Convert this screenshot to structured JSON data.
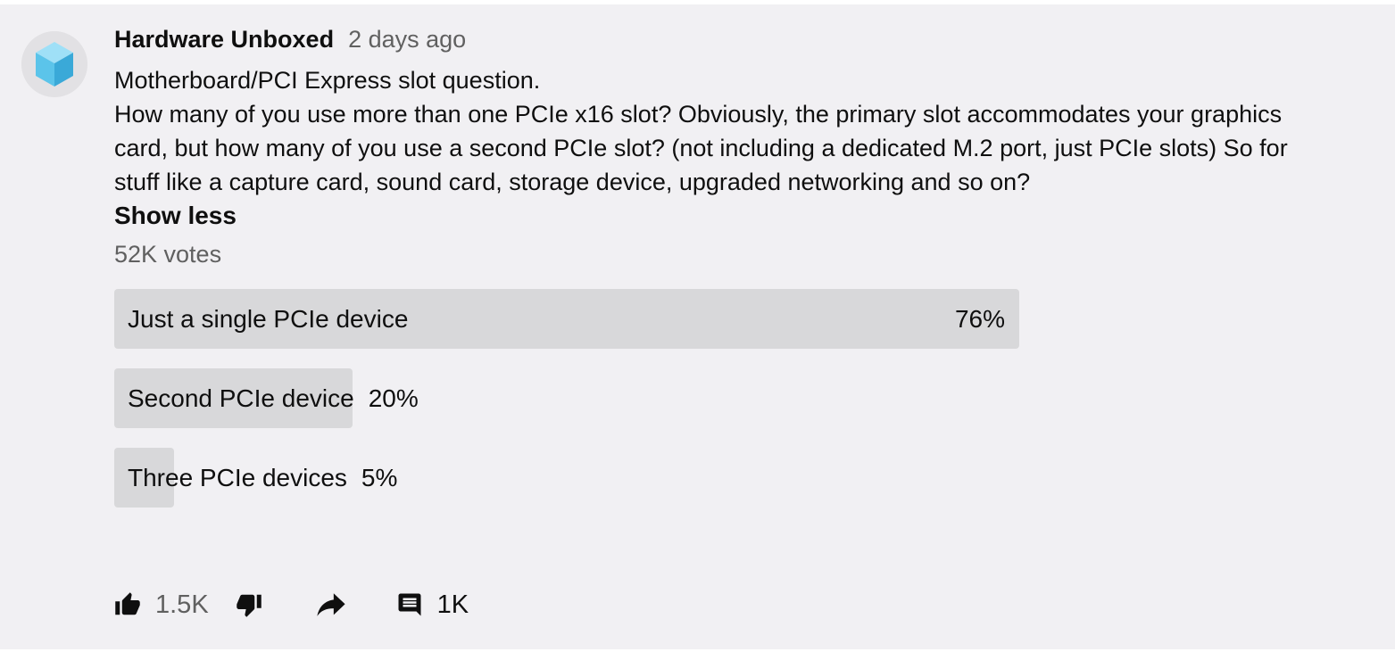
{
  "post": {
    "channel_name": "Hardware Unboxed",
    "time_ago": "2 days ago",
    "title": "Motherboard/PCI Express slot question.",
    "body": "How many of you use more than one PCIe x16 slot? Obviously, the primary slot accommodates your graphics card, but how many of you use a second PCIe slot? (not including a dedicated M.2 port, just PCIe slots) So for stuff like a capture card, sound card, storage device, upgraded networking and so on?",
    "show_less_label": "Show less",
    "votes_label": "52K votes"
  },
  "poll": {
    "options": [
      {
        "label": "Just a single PCIe device",
        "percent_label": "76%",
        "percent": 76
      },
      {
        "label": "Second PCIe device",
        "percent_label": "20%",
        "percent": 20
      },
      {
        "label": "Three PCIe devices",
        "percent_label": "5%",
        "percent": 5
      }
    ]
  },
  "actions": {
    "like_count": "1.5K",
    "comment_count": "1K"
  },
  "icons": {
    "avatar": "cube-logo-icon",
    "like": "thumbs-up-icon",
    "dislike": "thumbs-down-icon",
    "share": "share-arrow-icon",
    "comment": "comment-icon"
  },
  "colors": {
    "card_background": "#f1f0f3",
    "poll_fill": "#d8d8da",
    "secondary_text": "#606060",
    "avatar_cube": "#5bc4ea"
  }
}
